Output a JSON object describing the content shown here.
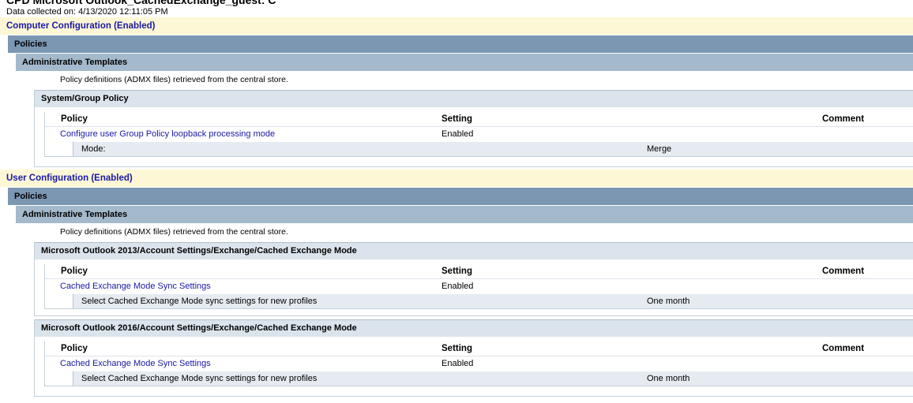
{
  "report": {
    "title": "CPD Microsoft Outlook_CachedExchange_guest: C",
    "collected": "Data collected on: 4/13/2020 12:11:05 PM"
  },
  "computer": {
    "header": "Computer Configuration (Enabled)",
    "policies_label": "Policies",
    "admin_label": "Administrative Templates",
    "admx_note": "Policy definitions (ADMX files) retrieved from the central store.",
    "extension": {
      "title": "System/Group Policy",
      "columns": {
        "policy": "Policy",
        "setting": "Setting",
        "comment": "Comment"
      },
      "policy_name": "Configure user Group Policy loopback processing mode",
      "policy_setting": "Enabled",
      "detail_label": "Mode:",
      "detail_value": "Merge"
    }
  },
  "user": {
    "header": "User Configuration (Enabled)",
    "policies_label": "Policies",
    "admin_label": "Administrative Templates",
    "admx_note": "Policy definitions (ADMX files) retrieved from the central store.",
    "ext2013": {
      "title": "Microsoft Outlook 2013/Account Settings/Exchange/Cached Exchange Mode",
      "columns": {
        "policy": "Policy",
        "setting": "Setting",
        "comment": "Comment"
      },
      "policy_name": "Cached Exchange Mode Sync Settings",
      "policy_setting": "Enabled",
      "detail_label": "Select Cached Exchange Mode sync settings for new profiles",
      "detail_value": "One month"
    },
    "ext2016": {
      "title": "Microsoft Outlook 2016/Account Settings/Exchange/Cached Exchange Mode",
      "columns": {
        "policy": "Policy",
        "setting": "Setting",
        "comment": "Comment"
      },
      "policy_name": "Cached Exchange Mode Sync Settings",
      "policy_setting": "Enabled",
      "detail_label": "Select Cached Exchange Mode sync settings for new profiles",
      "detail_value": "One month"
    }
  }
}
